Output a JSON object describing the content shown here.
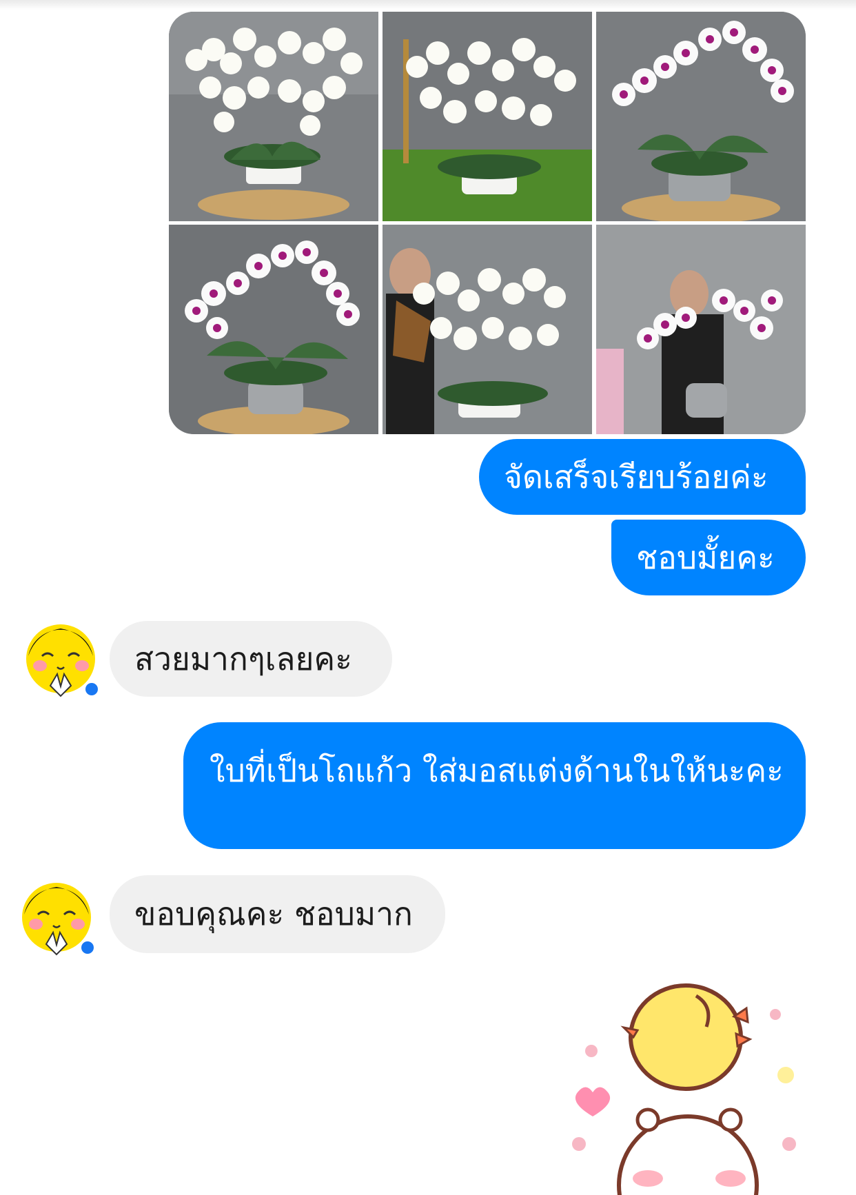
{
  "conversation": {
    "shared_photos": [
      {
        "name": "white orchids in white pot"
      },
      {
        "name": "white orchids on grass"
      },
      {
        "name": "pink-center orchids in silver pot"
      },
      {
        "name": "pink-center orchids close up"
      },
      {
        "name": "woman with white orchids"
      },
      {
        "name": "woman with pink-center orchids"
      }
    ],
    "messages": [
      {
        "direction": "outgoing",
        "text": "จัดเสร็จเรียบร้อยค่ะ"
      },
      {
        "direction": "outgoing",
        "text": "ชอบมั้ยคะ"
      },
      {
        "direction": "incoming",
        "text": "สวยมากๆเลยคะ"
      },
      {
        "direction": "outgoing",
        "text": "ใบที่เป็นโถแก้ว ใส่มอสแต่งด้านในให้นะคะ"
      },
      {
        "direction": "incoming",
        "text": "ขอบคุณคะ ชอบมาก"
      }
    ],
    "sticker": {
      "name": "yellow chick on white bear sticker"
    }
  },
  "colors": {
    "outgoing_bubble": "#0084ff",
    "incoming_bubble": "#f0f0f0"
  }
}
